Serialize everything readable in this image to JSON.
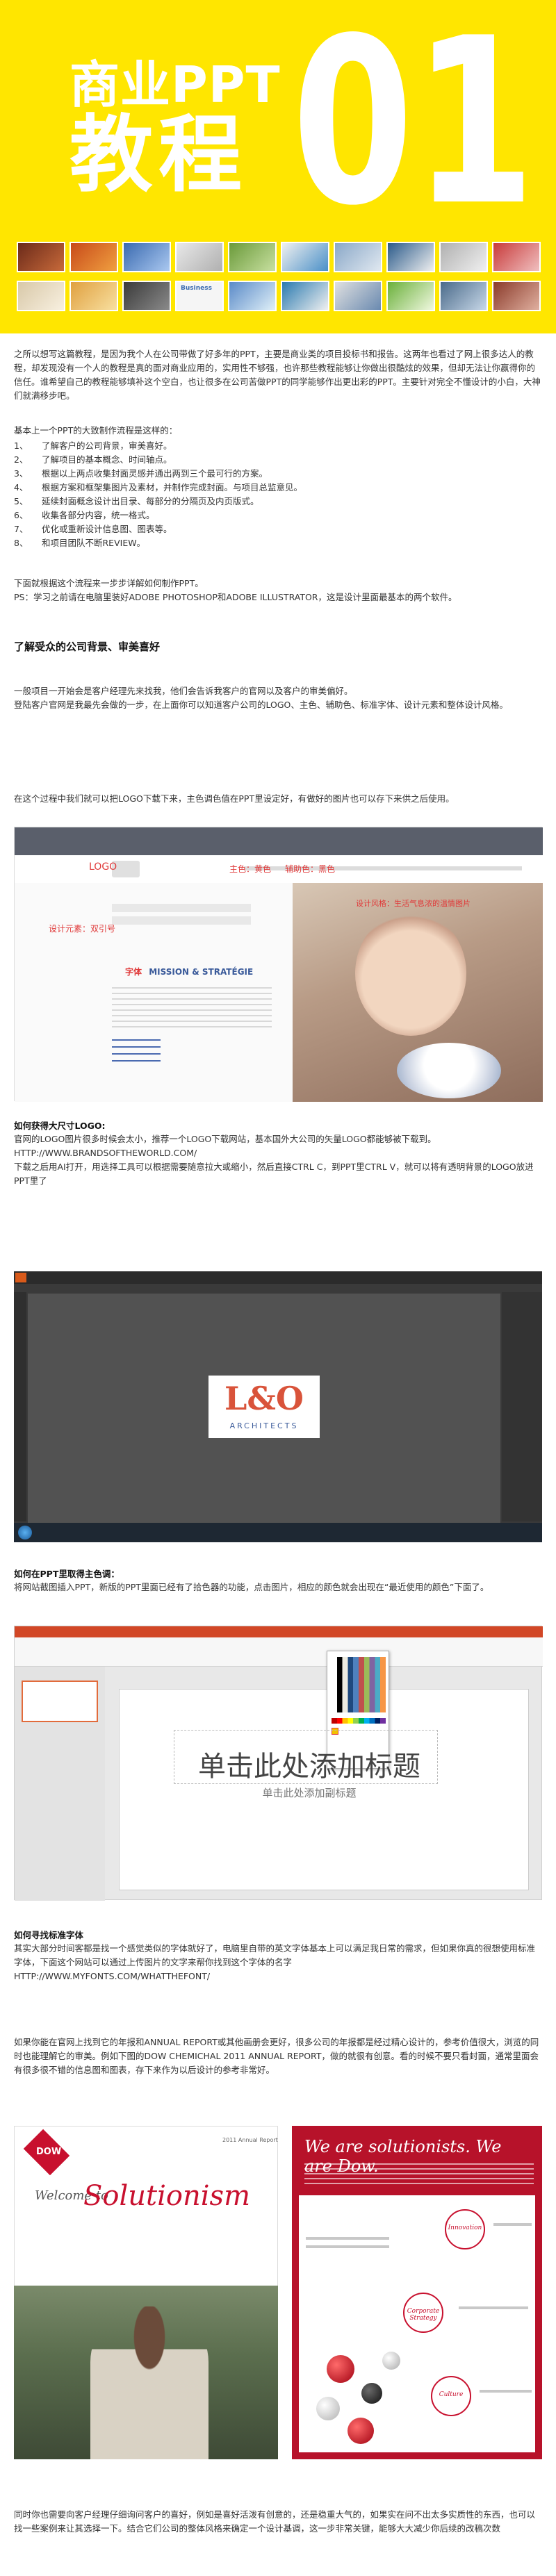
{
  "hero": {
    "title_line1": "商业PPT",
    "title_line2": "教程",
    "number": "01",
    "colors": {
      "background": "#ffe600",
      "text": "#ffffff"
    },
    "thumbnail_label": "Business"
  },
  "intro": {
    "paragraph": "之所以想写这篇教程，是因为我个人在公司带做了好多年的PPT，主要是商业类的项目投标书和报告。这两年也看过了网上很多达人的教程，却发现没有一个人的教程是真的面对商业应用的，实用性不够强，也许那些教程能够让你做出很酷炫的效果，但却无法让你赢得你的信任。谁希望自己的教程能够填补这个空白，也让很多在公司苦做PPT的同学能够作出更出彩的PPT。主要针对完全不懂设计的小白，大神们就满移步吧。",
    "steps_heading": "基本上一个PPT的大致制作流程是这样的：",
    "steps": [
      {
        "num": "1、",
        "text": "了解客户的公司背景，审美喜好。"
      },
      {
        "num": "2、",
        "text": "了解项目的基本概念、时间轴点。"
      },
      {
        "num": "3、",
        "text": "根据以上两点收集封面灵感并通出两到三个最可行的方案。"
      },
      {
        "num": "4、",
        "text": "根据方案和框架集图片及素材，并制作完成封面。与项目总监意见。"
      },
      {
        "num": "5、",
        "text": "延续封面概念设计出目录、每部分的分隔页及内页版式。"
      },
      {
        "num": "6、",
        "text": "收集各部分内容，统一格式。"
      },
      {
        "num": "7、",
        "text": "优化或重新设计信息图、图表等。"
      },
      {
        "num": "8、",
        "text": "和项目团队不断REVIEW。"
      }
    ],
    "note1": "下面就根据这个流程来一步步详解如何制作PPT。",
    "note2": "PS：学习之前请在电脑里装好ADOBE PHOTOSHOP和ADOBE ILLUSTRATOR，这是设计里面最基本的两个软件。"
  },
  "section1": {
    "heading": "了解受众的公司背景、审美喜好",
    "p1": "一般项目一开始会是客户经理先来找我，他们会告诉我客户的官网以及客户的审美偏好。",
    "p2": "登陆客户官网是我最先会做的一步，在上面你可以知道客户公司的LOGO、主色、辅助色、标准字体、设计元素和整体设计风格。",
    "p3": "在这个过程中我们就可以把LOGO下载下来，主色调色值在PPT里设定好，有做好的图片也可以存下来供之后使用。",
    "shot": {
      "logo_label": "LOGO",
      "color_label": "主色：黄色",
      "aux_label": "辅助色：黑色",
      "element_label": "设计元素：双引号",
      "image_label": "设计风格：生活气息浓的温情图片",
      "font_label": "字体",
      "font_name": "MISSION & STRATÉGIE",
      "colors": {
        "main": "#f2c200",
        "label": "#e03a3a",
        "bar": "#5a5f6b"
      }
    }
  },
  "section2": {
    "heading": "如何获得大尺寸LOGO:",
    "p1": "官网的LOGO图片很多时候会太小，推荐一个LOGO下载网站，基本国外大公司的矢量LOGO都能够被下载到。",
    "url": "HTTP://WWW.BRANDSOFTHEWORLD.COM/",
    "p2": "下载之后用AI打开，用选择工具可以根据需要随意拉大或缩小，然后直接CTRL C，到PPT里CTRL V，就可以将有透明背景的LOGO放进PPT里了",
    "logo_text": "L&O",
    "logo_sub": "ARCHITECTS"
  },
  "section3": {
    "heading": "如何在PPT里取得主色调：",
    "p1": "将网站截图插入PPT，新版的PPT里面已经有了拾色器的功能，点击图片，相应的颜色就会出现在“最近使用的颜色”下面了。",
    "slide_title": "单击此处添加标题",
    "slide_subtitle": "单击此处添加副标题"
  },
  "section4": {
    "heading": "如何寻找标准字体",
    "p1": "其实大部分时间客都是找一个感觉类似的字体就好了，电脑里自带的英文字体基本上可以满足我日常的需求，但如果你真的很想使用标准字体，下面这个网站可以通过上传图片的文字来帮你找到这个字体的名字",
    "url": "HTTP://WWW.MYFONTS.COM/WHATTHEFONT/",
    "p2": "如果你能在官网上找到它的年报和ANNUAL REPORT或其他画册会更好，很多公司的年报都是经过精心设计的，参考价值很大，浏览的同时也能理解它的审美。例如下图的DOW CHEMICHAL 2011 ANNUAL REPORT，做的就很有创意。看的时候不要只看封面，通常里面会有很多很不错的信息图和图表，存下来作为以后设计的参考非常好。",
    "dow_logo": "DOW",
    "dow_welcome": "Welcome to",
    "dow_solutionism": "Solutionism",
    "dow_report_tag": "2011 Annual Report",
    "dow_headline": "We are solutionists. We are Dow.",
    "circles": [
      "Innovation",
      "Corporate Strategy",
      "Culture"
    ],
    "p3": "同时你也需要向客户经理仔细询问客户的喜好，例如是喜好活泼有创意的，还是稳重大气的，如果实在问不出太多实质性的东西，也可以找一些案例来让其选择一下。结合它们公司的整体风格来确定一个设计基调，这一步非常关键，能够大大减少你后续的改稿次数"
  }
}
